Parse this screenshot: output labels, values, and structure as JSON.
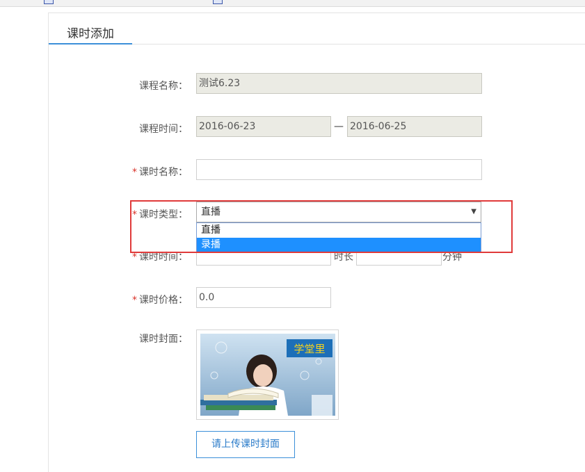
{
  "tab": {
    "title": "课时添加"
  },
  "form": {
    "course_name": {
      "label": "课程名称：",
      "value": "测试6.23"
    },
    "course_time": {
      "label": "课程时间：",
      "start": "2016-06-23",
      "separator": "—",
      "end": "2016-06-25"
    },
    "lesson_name": {
      "required_mark": "*",
      "label": "课时名称：",
      "value": ""
    },
    "lesson_type": {
      "required_mark": "*",
      "label": "课时类型：",
      "selected": "直播",
      "options": [
        "直播",
        "录播"
      ],
      "highlighted_option": "录播"
    },
    "lesson_time": {
      "required_mark": "*",
      "label": "课时时间：",
      "duration_label": "时长",
      "unit": "分钟"
    },
    "lesson_price": {
      "required_mark": "*",
      "label": "课时价格：",
      "value": "0.0"
    },
    "lesson_cover": {
      "label": "课时封面：",
      "logo_text": "学堂里",
      "upload_label": "请上传课时封面"
    }
  },
  "colors": {
    "accent": "#3b8fd9",
    "highlight_box": "#e03a3a",
    "selected_option": "#1e90ff",
    "required": "#d9332a"
  }
}
